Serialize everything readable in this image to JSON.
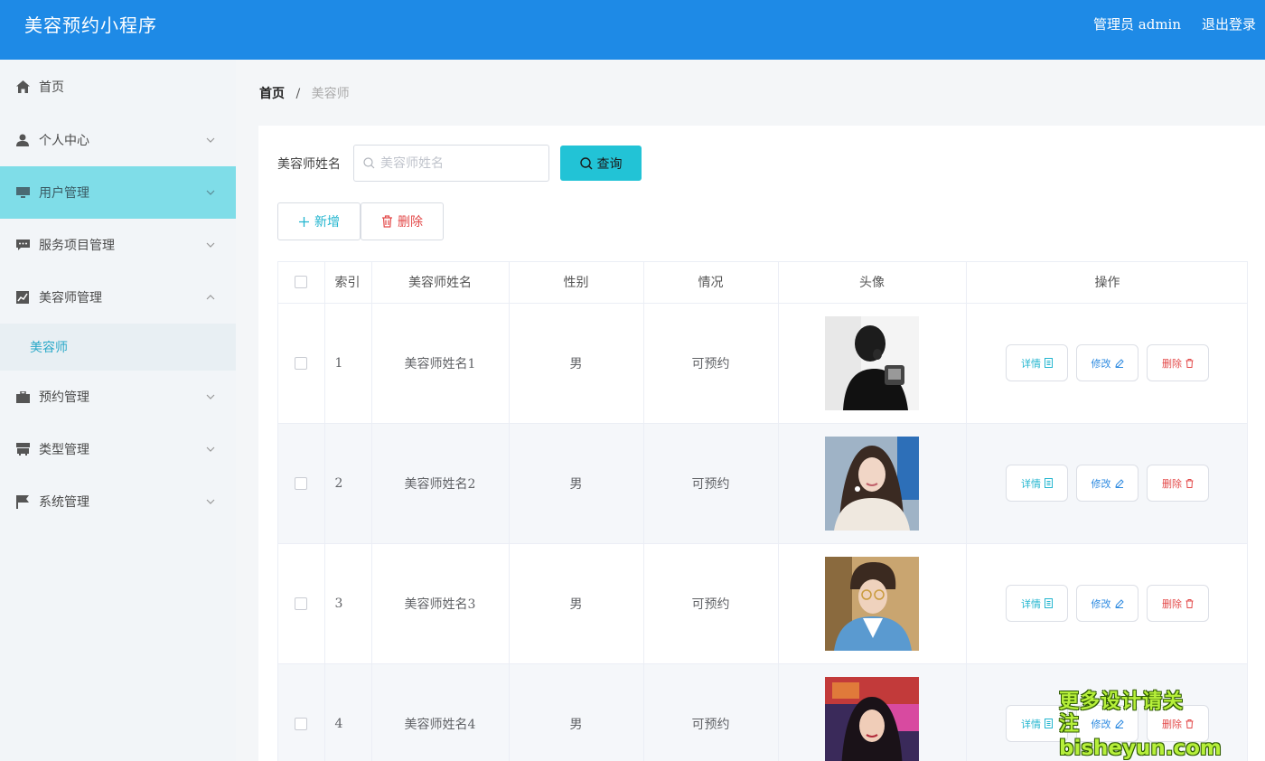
{
  "header": {
    "app_title": "美容预约小程序",
    "admin_label": "管理员 admin",
    "logout_label": "退出登录",
    "background_color": "#1e8ae6"
  },
  "sidebar": {
    "items": [
      {
        "label": "首页",
        "icon": "home-icon",
        "has_submenu": false
      },
      {
        "label": "个人中心",
        "icon": "user-icon",
        "has_submenu": true,
        "expanded": false
      },
      {
        "label": "用户管理",
        "icon": "monitor-icon",
        "has_submenu": true,
        "expanded": false,
        "active": true
      },
      {
        "label": "服务项目管理",
        "icon": "message-icon",
        "has_submenu": true,
        "expanded": false
      },
      {
        "label": "美容师管理",
        "icon": "chart-icon",
        "has_submenu": true,
        "expanded": true
      },
      {
        "label": "预约管理",
        "icon": "briefcase-icon",
        "has_submenu": true,
        "expanded": false
      },
      {
        "label": "类型管理",
        "icon": "store-icon",
        "has_submenu": true,
        "expanded": false
      },
      {
        "label": "系统管理",
        "icon": "flag-icon",
        "has_submenu": true,
        "expanded": false
      }
    ],
    "submenu_beautician": "美容师",
    "active_color": "#7fdde8"
  },
  "breadcrumb": {
    "home": "首页",
    "separator": "/",
    "current": "美容师"
  },
  "search": {
    "label": "美容师姓名",
    "placeholder": "美容师姓名",
    "value": "",
    "query_label": "查询"
  },
  "actions": {
    "add_label": "新增",
    "delete_label": "删除"
  },
  "table": {
    "columns": [
      "索引",
      "美容师姓名",
      "性别",
      "情况",
      "头像",
      "操作"
    ],
    "rows": [
      {
        "index": "1",
        "name": "美容师姓名1",
        "gender": "男",
        "status": "可预约",
        "avatar": "grayscale-man-portrait"
      },
      {
        "index": "2",
        "name": "美容师姓名2",
        "gender": "男",
        "status": "可预约",
        "avatar": "woman-long-hair-portrait"
      },
      {
        "index": "3",
        "name": "美容师姓名3",
        "gender": "男",
        "status": "可预约",
        "avatar": "young-man-glasses-portrait"
      },
      {
        "index": "4",
        "name": "美容师姓名4",
        "gender": "男",
        "status": "可预约",
        "avatar": "woman-neon-portrait"
      }
    ],
    "op_labels": {
      "detail": "详情",
      "edit": "修改",
      "delete": "删除"
    }
  },
  "watermark": {
    "line1": "更多设计请关注",
    "line2": "bisheyun.com"
  }
}
